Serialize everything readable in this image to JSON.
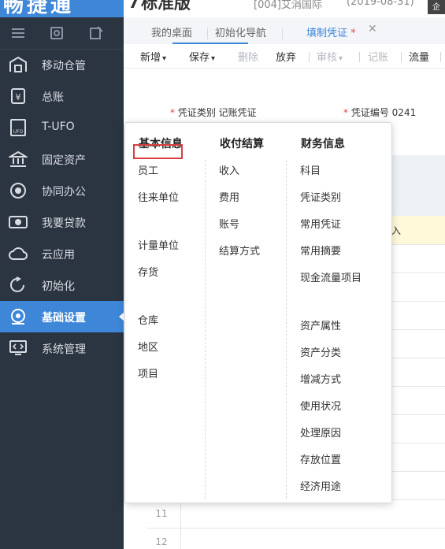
{
  "app": {
    "logo_text": "畅捷通",
    "edition": "标准版",
    "org": "[004]艾涓国际",
    "date": "(2019-08-31)",
    "corner": "企"
  },
  "sidebar": {
    "items": [
      {
        "label": "移动仓管",
        "icon": "warehouse-icon"
      },
      {
        "label": "总账",
        "icon": "ledger-icon"
      },
      {
        "label": "T-UFO",
        "icon": "ufo-icon"
      },
      {
        "label": "固定资产",
        "icon": "bank-icon"
      },
      {
        "label": "协同办公",
        "icon": "collab-icon"
      },
      {
        "label": "我要贷款",
        "icon": "loan-icon"
      },
      {
        "label": "云应用",
        "icon": "cloud-icon"
      },
      {
        "label": "初始化",
        "icon": "init-icon"
      },
      {
        "label": "基础设置",
        "icon": "settings-icon"
      },
      {
        "label": "系统管理",
        "icon": "system-icon"
      }
    ],
    "active_index": 8
  },
  "tabs": [
    {
      "label": "我的桌面"
    },
    {
      "label": "初始化导航"
    },
    {
      "label": "填制凭证",
      "active": true
    }
  ],
  "toolbar": {
    "new": "新增",
    "save": "保存",
    "delete": "删除",
    "abandon": "放弃",
    "audit": "审核",
    "post": "记账",
    "flow": "流量"
  },
  "voucher": {
    "type_label": "凭证类别",
    "type_value": "记账凭证",
    "number_label": "凭证编号",
    "number_value": "0241",
    "required_mark": "*"
  },
  "grid": {
    "row_numbers": [
      "11",
      "12"
    ],
    "highlight_text": "入"
  },
  "menu": {
    "columns": [
      {
        "title": "基本信息",
        "items": [
          "员工",
          "往来单位",
          "计量单位",
          "存货",
          "仓库",
          "地区",
          "项目"
        ]
      },
      {
        "title": "收付结算",
        "items": [
          "收入",
          "费用",
          "账号",
          "结算方式"
        ]
      },
      {
        "title": "财务信息",
        "items": [
          "科目",
          "凭证类别",
          "常用凭证",
          "常用摘要",
          "现金流量项目",
          "资产属性",
          "资产分类",
          "增减方式",
          "使用状况",
          "处理原因",
          "存放位置",
          "经济用途"
        ]
      }
    ]
  },
  "colors": {
    "sidebar_bg": "#2b3441",
    "accent": "#3d86d8",
    "highlight_box": "#d84040"
  }
}
